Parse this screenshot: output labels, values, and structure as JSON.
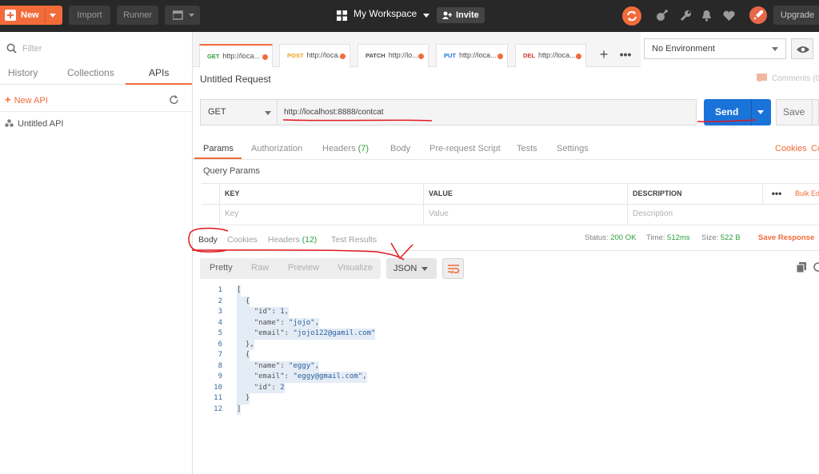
{
  "topbar": {
    "new_label": "New",
    "import_label": "Import",
    "runner_label": "Runner",
    "workspace": "My Workspace",
    "invite": "Invite",
    "upgrade": "Upgrade"
  },
  "sidebar": {
    "filter_placeholder": "Filter",
    "tabs": [
      "History",
      "Collections",
      "APIs"
    ],
    "active_tab": "APIs",
    "new_api": "New API",
    "items": [
      "Untitled API"
    ]
  },
  "request_tabs": [
    {
      "method": "GET",
      "url": "http://loca..."
    },
    {
      "method": "POST",
      "url": "http://loca..."
    },
    {
      "method": "PATCH",
      "url": "http://lo..."
    },
    {
      "method": "PUT",
      "url": "http://loca..."
    },
    {
      "method": "DEL",
      "url": "http://loca..."
    }
  ],
  "environment": "No Environment",
  "request": {
    "title": "Untitled Request",
    "comments": "Comments (0",
    "method": "GET",
    "url": "http://localhost:8888/contcat",
    "send": "Send",
    "save": "Save"
  },
  "request_subtabs": {
    "params": "Params",
    "authorization": "Authorization",
    "headers": "Headers",
    "headers_count": "(7)",
    "body": "Body",
    "prerequest": "Pre-request Script",
    "tests": "Tests",
    "settings": "Settings",
    "cookies": "Cookies",
    "code": "Co"
  },
  "query_params": {
    "title": "Query Params",
    "columns": [
      "KEY",
      "VALUE",
      "DESCRIPTION"
    ],
    "placeholders": [
      "Key",
      "Value",
      "Description"
    ],
    "bulk_edit": "Bulk Ed"
  },
  "response": {
    "tabs": {
      "body": "Body",
      "cookies": "Cookies",
      "headers": "Headers",
      "headers_count": "(12)",
      "test_results": "Test Results"
    },
    "status_label": "Status:",
    "status": "200 OK",
    "time_label": "Time:",
    "time": "512ms",
    "size_label": "Size:",
    "size": "522 B",
    "save_response": "Save Response",
    "views": [
      "Pretty",
      "Raw",
      "Preview",
      "Visualize"
    ],
    "active_view": "Pretty",
    "format": "JSON"
  },
  "code_lines": [
    {
      "n": "1",
      "parts": [
        [
          "p",
          "["
        ]
      ]
    },
    {
      "n": "2",
      "parts": [
        [
          "p",
          "  {"
        ]
      ]
    },
    {
      "n": "3",
      "parts": [
        [
          "p",
          "    "
        ],
        [
          "k",
          "\"id\""
        ],
        [
          "p",
          ": "
        ],
        [
          "v",
          "1"
        ],
        [
          "p",
          ","
        ]
      ]
    },
    {
      "n": "4",
      "parts": [
        [
          "p",
          "    "
        ],
        [
          "k",
          "\"name\""
        ],
        [
          "p",
          ": "
        ],
        [
          "v",
          "\"jojo\""
        ],
        [
          "p",
          ","
        ]
      ]
    },
    {
      "n": "5",
      "parts": [
        [
          "p",
          "    "
        ],
        [
          "k",
          "\"email\""
        ],
        [
          "p",
          ": "
        ],
        [
          "v",
          "\"jojo122@gamil.com\""
        ]
      ]
    },
    {
      "n": "6",
      "parts": [
        [
          "p",
          "  },"
        ]
      ]
    },
    {
      "n": "7",
      "parts": [
        [
          "p",
          "  {"
        ]
      ]
    },
    {
      "n": "8",
      "parts": [
        [
          "p",
          "    "
        ],
        [
          "k",
          "\"name\""
        ],
        [
          "p",
          ": "
        ],
        [
          "v",
          "\"eggy\""
        ],
        [
          "p",
          ","
        ]
      ]
    },
    {
      "n": "9",
      "parts": [
        [
          "p",
          "    "
        ],
        [
          "k",
          "\"email\""
        ],
        [
          "p",
          ": "
        ],
        [
          "v",
          "\"eggy@gmail.com\""
        ],
        [
          "p",
          ","
        ]
      ]
    },
    {
      "n": "10",
      "parts": [
        [
          "p",
          "    "
        ],
        [
          "k",
          "\"id\""
        ],
        [
          "p",
          ": "
        ],
        [
          "v",
          "2"
        ]
      ]
    },
    {
      "n": "11",
      "parts": [
        [
          "p",
          "  }"
        ]
      ]
    },
    {
      "n": "12",
      "parts": [
        [
          "p",
          "]"
        ]
      ]
    }
  ],
  "colors": {
    "accent": "#f26b3a",
    "send_blue": "#1a73d9",
    "status_green": "#2e9e3e",
    "annotation_red": "#e0191e"
  }
}
